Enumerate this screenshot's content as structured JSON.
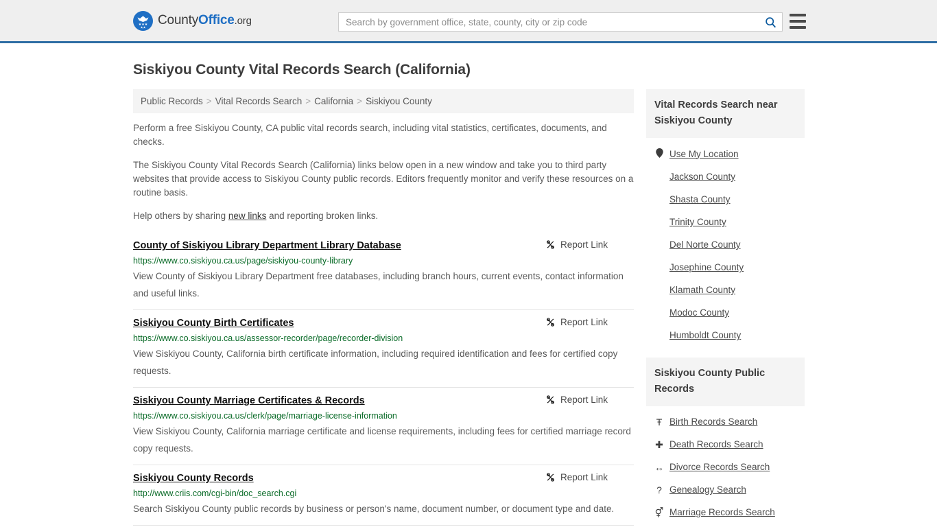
{
  "header": {
    "brand": {
      "part1": "County",
      "part2": "Office",
      "part3": ".org",
      "logo_icon": "eagle-seal-logo"
    },
    "search": {
      "placeholder": "Search by government office, state, county, city or zip code",
      "value": "",
      "search_icon": "search-icon"
    },
    "menu_icon": "hamburger-menu-icon"
  },
  "page": {
    "title": "Siskiyou County Vital Records Search (California)"
  },
  "breadcrumb": {
    "separator": ">",
    "items": [
      {
        "label": "Public Records"
      },
      {
        "label": "Vital Records Search"
      },
      {
        "label": "California"
      },
      {
        "label": "Siskiyou County"
      }
    ]
  },
  "intro": {
    "paragraph1": "Perform a free Siskiyou County, CA public vital records search, including vital statistics, certificates, documents, and checks.",
    "paragraph2": "The Siskiyou County Vital Records Search (California) links below open in a new window and take you to third party websites that provide access to Siskiyou County public records. Editors frequently monitor and verify these resources on a routine basis.",
    "paragraph3_before": "Help others by sharing ",
    "paragraph3_link": "new links",
    "paragraph3_after": " and reporting broken links."
  },
  "results": {
    "report_label": "Report Link",
    "report_icon": "broken-link-icon",
    "items": [
      {
        "title": "County of Siskiyou Library Department Library Database",
        "url": "https://www.co.siskiyou.ca.us/page/siskiyou-county-library",
        "description": "View County of Siskiyou Library Department free databases, including branch hours, current events, contact information and useful links."
      },
      {
        "title": "Siskiyou County Birth Certificates",
        "url": "https://www.co.siskiyou.ca.us/assessor-recorder/page/recorder-division",
        "description": "View Siskiyou County, California birth certificate information, including required identification and fees for certified copy requests."
      },
      {
        "title": "Siskiyou County Marriage Certificates & Records",
        "url": "https://www.co.siskiyou.ca.us/clerk/page/marriage-license-information",
        "description": "View Siskiyou County, California marriage certificate and license requirements, including fees for certified marriage record copy requests."
      },
      {
        "title": "Siskiyou County Records",
        "url": "http://www.criis.com/cgi-bin/doc_search.cgi",
        "description": "Search Siskiyou County public records by business or person's name, document number, or document type and date."
      }
    ]
  },
  "sidebar": {
    "nearby": {
      "heading": "Vital Records Search near Siskiyou County",
      "items": [
        {
          "label": "Use My Location",
          "icon": "location-pin-icon"
        },
        {
          "label": "Jackson County",
          "icon": ""
        },
        {
          "label": "Shasta County",
          "icon": ""
        },
        {
          "label": "Trinity County",
          "icon": ""
        },
        {
          "label": "Del Norte County",
          "icon": ""
        },
        {
          "label": "Josephine County",
          "icon": ""
        },
        {
          "label": "Klamath County",
          "icon": ""
        },
        {
          "label": "Modoc County",
          "icon": ""
        },
        {
          "label": "Humboldt County",
          "icon": ""
        }
      ]
    },
    "public_records": {
      "heading": "Siskiyou County Public Records",
      "items": [
        {
          "label": "Birth Records Search",
          "icon": "baby-icon",
          "glyph": "Ŧ"
        },
        {
          "label": "Death Records Search",
          "icon": "cross-icon",
          "glyph": "✚"
        },
        {
          "label": "Divorce Records Search",
          "icon": "double-arrow-icon",
          "glyph": "↔"
        },
        {
          "label": "Genealogy Search",
          "icon": "question-mark-icon",
          "glyph": "?"
        },
        {
          "label": "Marriage Records Search",
          "icon": "male-female-icon",
          "glyph": "⚥"
        }
      ]
    }
  },
  "colors": {
    "brand_blue": "#1f6fc4",
    "header_bg": "#efefef",
    "header_border": "#2e6da4",
    "url_green": "#0a6b28",
    "panel_bg": "#f4f4f4"
  }
}
